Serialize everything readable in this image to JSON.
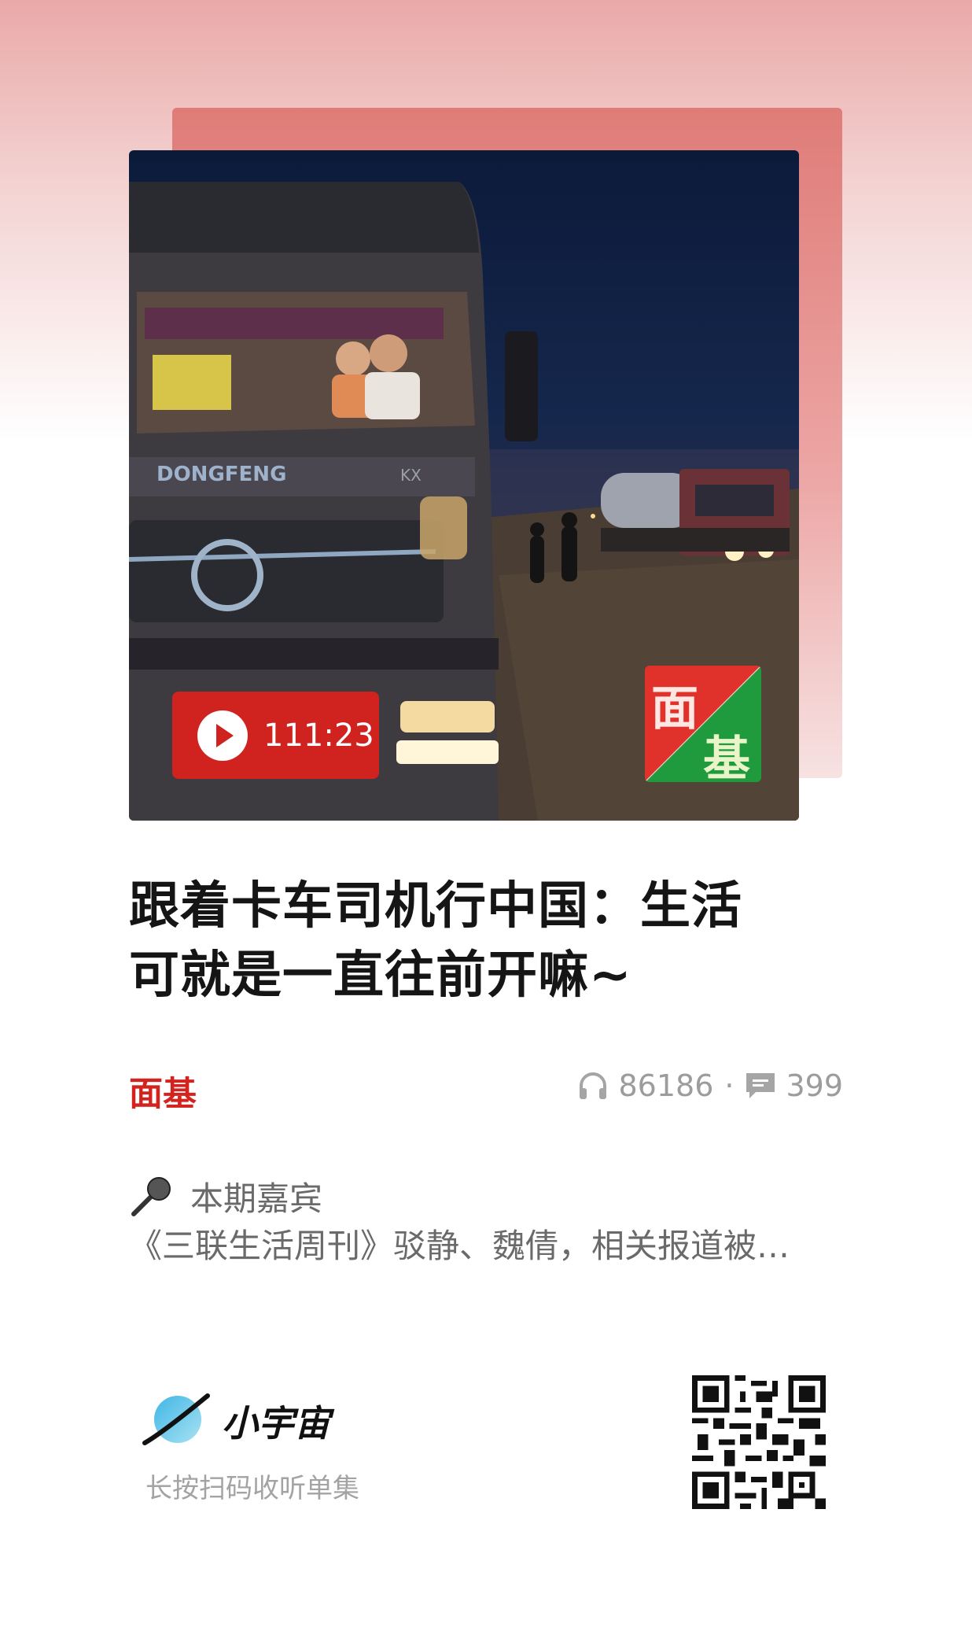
{
  "episode": {
    "duration": "111:23",
    "title_line1": "跟着卡车司机行中国：生活",
    "title_line2": "可就是一直往前开嘛~"
  },
  "cover": {
    "truck_brand_text": "DONGFENG",
    "truck_model_text": "KX",
    "logo_char_1": "面",
    "logo_char_2": "基"
  },
  "podcast": {
    "name": "面基"
  },
  "stats": {
    "plays": "86186",
    "separator": "·",
    "comments": "399"
  },
  "guest": {
    "label": "本期嘉宾",
    "text": "《三联生活周刊》驳静、魏倩，相关报道被…"
  },
  "footer": {
    "brand": "小宇宙",
    "hint": "长按扫码收听单集"
  },
  "colors": {
    "accent": "#d4231f",
    "muted": "#9c9c9c"
  },
  "icons": [
    "play-icon",
    "headphones-icon",
    "comment-icon",
    "microphone-icon",
    "planet-icon",
    "qr-code"
  ]
}
